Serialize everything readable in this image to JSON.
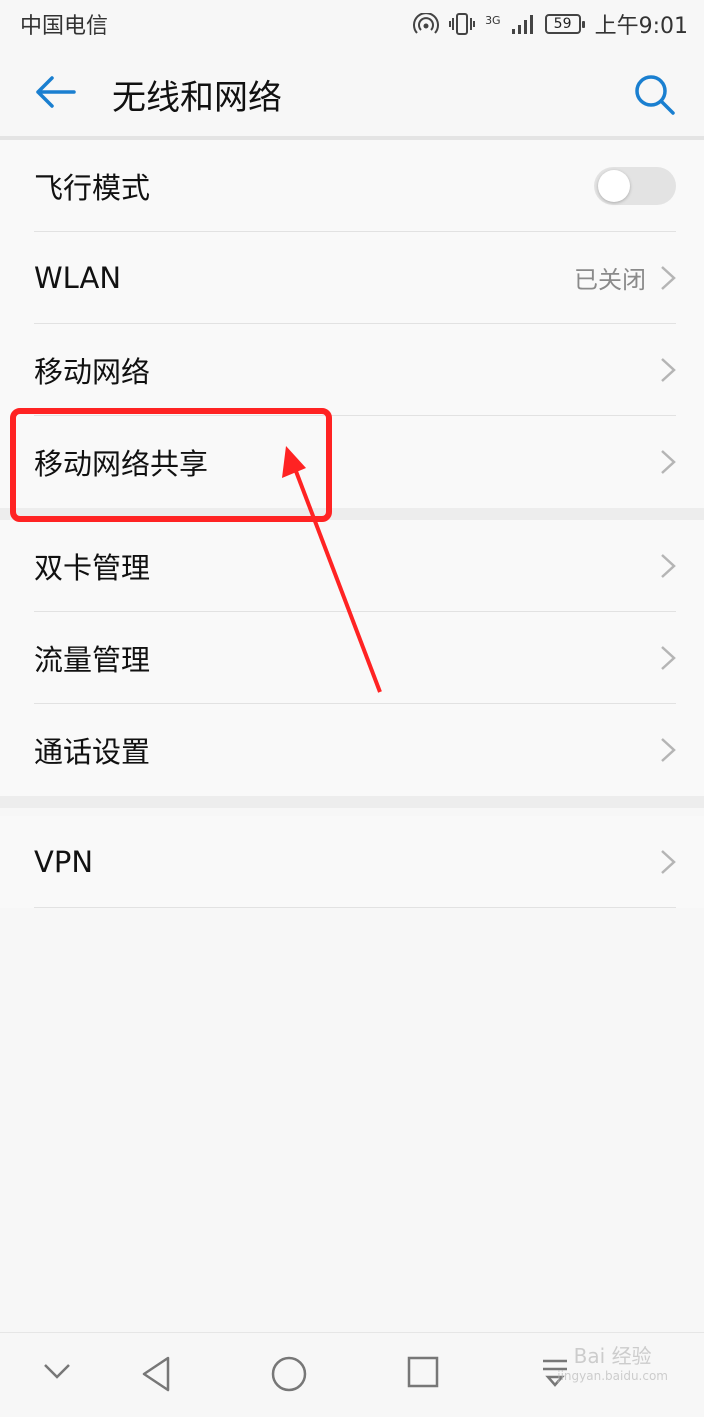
{
  "status_bar": {
    "carrier": "中国电信",
    "network": "3G",
    "battery": "59",
    "time": "上午9:01"
  },
  "app_bar": {
    "title": "无线和网络"
  },
  "groups": [
    {
      "items": [
        {
          "label": "飞行模式",
          "control": "toggle",
          "toggle_on": false
        },
        {
          "label": "WLAN",
          "status": "已关闭",
          "control": "chevron"
        },
        {
          "label": "移动网络",
          "control": "chevron"
        },
        {
          "label": "移动网络共享",
          "control": "chevron"
        }
      ]
    },
    {
      "items": [
        {
          "label": "双卡管理",
          "control": "chevron"
        },
        {
          "label": "流量管理",
          "control": "chevron"
        },
        {
          "label": "通话设置",
          "control": "chevron"
        }
      ]
    },
    {
      "items": [
        {
          "label": "VPN",
          "control": "chevron"
        }
      ]
    }
  ],
  "annotation": {
    "color": "#ff2323"
  },
  "watermark": {
    "brand": "Bai 经验",
    "url": "jingyan.baidu.com"
  },
  "colors": {
    "accent": "#1a7fd0",
    "toggle_off": "#e3e3e3"
  }
}
